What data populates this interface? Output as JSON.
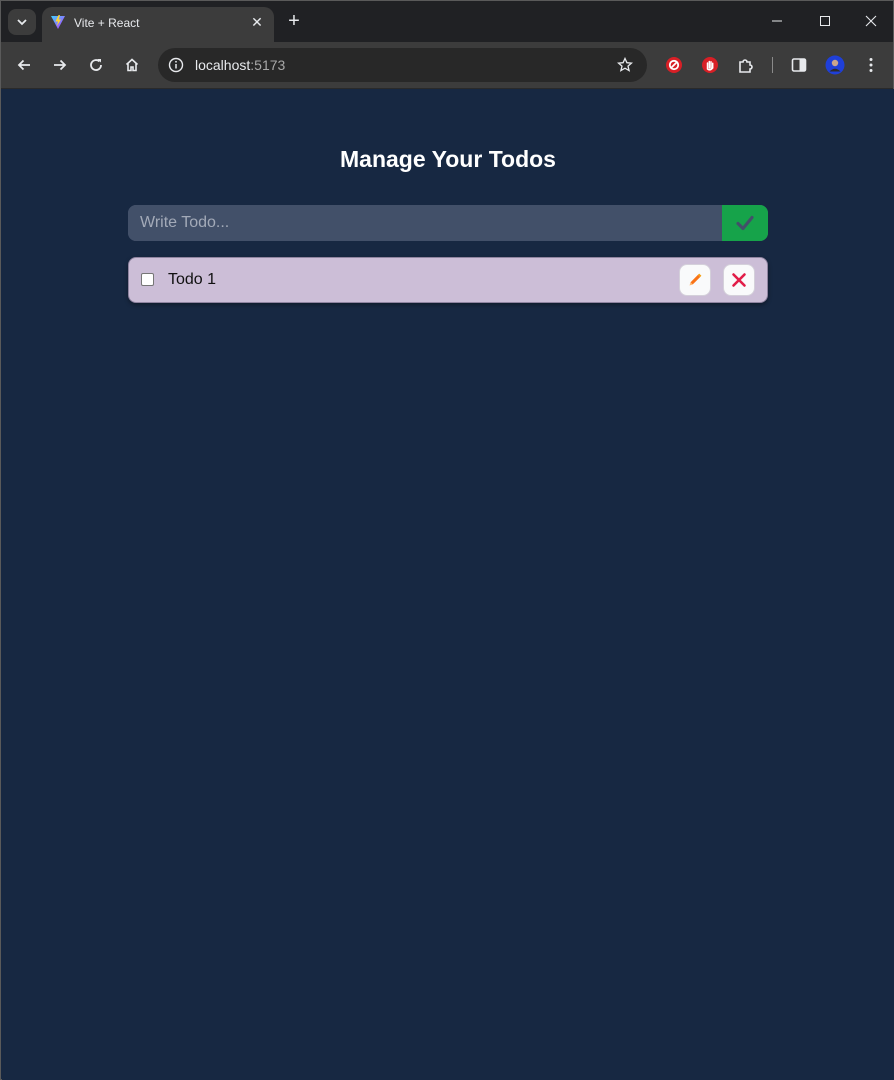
{
  "browser": {
    "tab_title": "Vite + React",
    "url_host": "localhost",
    "url_port": ":5173",
    "colors": {
      "tab_bg": "#3c3c3c",
      "strip_bg": "#202124",
      "toolbar_bg": "#3c3c3c"
    }
  },
  "app": {
    "heading": "Manage Your Todos",
    "input_placeholder": "Write Todo...",
    "input_value": "",
    "todos": [
      {
        "text": "Todo 1",
        "completed": false
      }
    ],
    "colors": {
      "page_bg": "#172842",
      "input_bg": "#425069",
      "submit_bg": "#16a34a",
      "todo_bg": "#ccbed7",
      "edit_icon": "#f97316",
      "delete_icon": "#e11d48"
    }
  }
}
